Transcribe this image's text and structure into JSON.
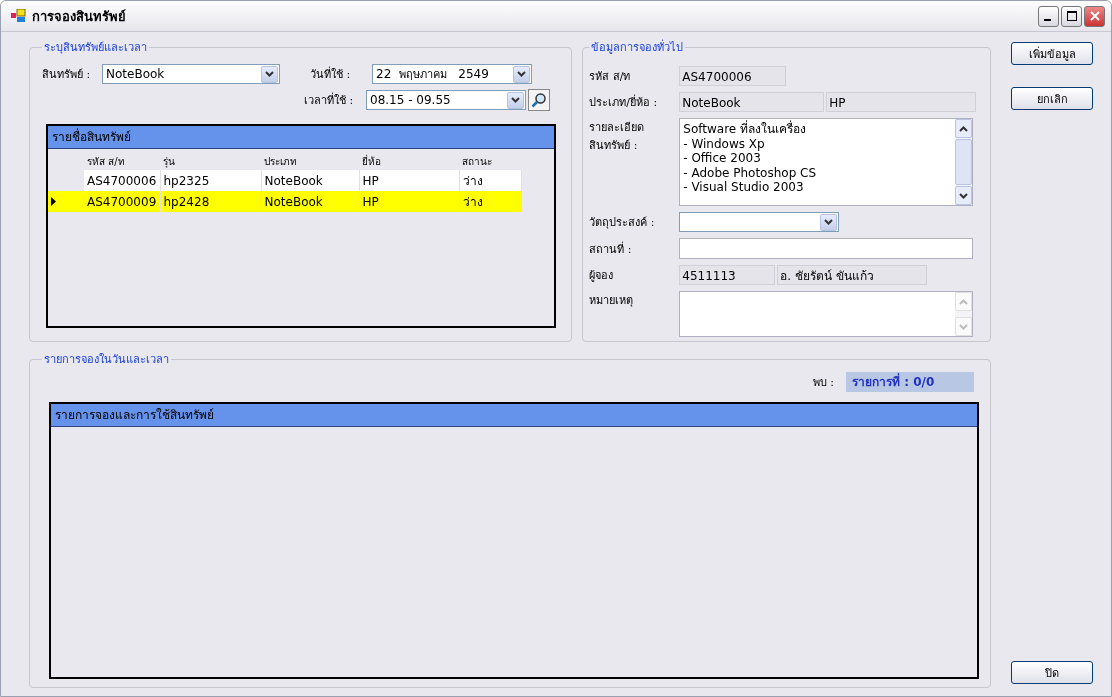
{
  "window": {
    "title": "การจองสินทรัพย์"
  },
  "asset_group": {
    "title": "ระบุสินทรัพย์และเวลา",
    "asset": {
      "label": "สินทรัพย์ :",
      "value": "NoteBook"
    },
    "date": {
      "label": "วันที่ใช้ :",
      "day": "22",
      "month": "พฤษภาคม",
      "year": "2549"
    },
    "time": {
      "label": "เวลาที่ใช้ :",
      "value": "08.15 - 09.55"
    },
    "asset_list": {
      "title": "รายชื่อสินทรัพย์",
      "columns": [
        "รหัส ส/ท",
        "รุ่น",
        "ประเภท",
        "ยี่ห้อ",
        "สถานะ"
      ],
      "rows": [
        {
          "cells": [
            "AS4700006",
            "hp2325",
            "NoteBook",
            "HP",
            "ว่าง"
          ],
          "selected": false
        },
        {
          "cells": [
            "AS4700009",
            "hp2428",
            "NoteBook",
            "HP",
            "ว่าง"
          ],
          "selected": true
        }
      ]
    }
  },
  "info_group": {
    "title": "ข้อมูลการจองทั่วไป",
    "code": {
      "label": "รหัส ส/ท",
      "value": "AS4700006"
    },
    "type_brand": {
      "label": "ประเภท/ยี่ห้อ :",
      "type": "NoteBook",
      "brand": "HP"
    },
    "details": {
      "label": "รายละเอียด\nสินทรัพย์ :",
      "lines": [
        "Software ที่ลงในเครื่อง",
        "- Windows Xp",
        "- Office 2003",
        "- Adobe Photoshop CS",
        "- Visual Studio 2003"
      ]
    },
    "purpose": {
      "label": "วัตถุประสงค์ :"
    },
    "place": {
      "label": "สถานที่ :"
    },
    "booker": {
      "label": "ผู้จอง",
      "id": "4511113",
      "name": "อ. ชัยรัตน์  ขันแก้ว"
    },
    "note": {
      "label": "หมายเหตุ"
    }
  },
  "buttons": [
    "เพิ่มข้อมูล",
    "ยกเลิก"
  ],
  "booking_group": {
    "title": "รายการจองในวันและเวลา",
    "found_label": "พบ :",
    "found_value": "รายการที่ : 0/0",
    "grid_title": "รายการจองและการใช้สินทรัพย์"
  },
  "close_button": "ปิด"
}
